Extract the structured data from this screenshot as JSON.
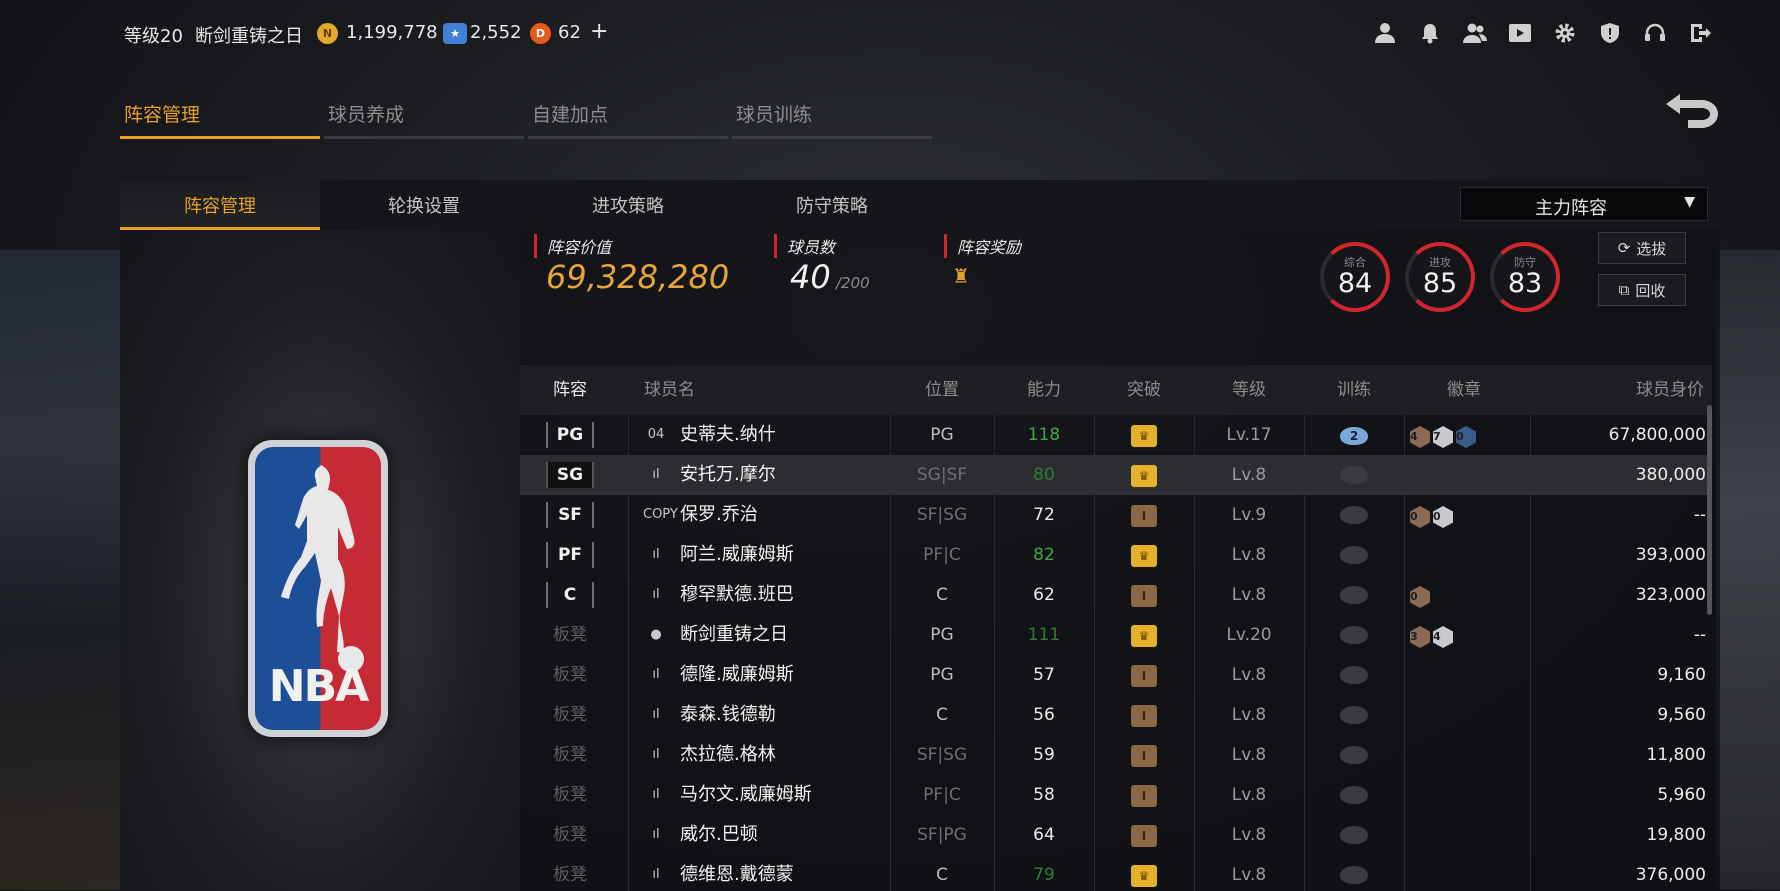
{
  "topbar": {
    "level": "等级20",
    "player_name": "断剑重铸之日",
    "coins": "1,199,778",
    "stars": "2,552",
    "tickets": "62",
    "add_label": "+",
    "icons": [
      "profile-icon",
      "bell-icon",
      "friends-icon",
      "video-icon",
      "gear-icon",
      "shield-icon",
      "headset-icon",
      "exit-icon"
    ]
  },
  "main_tabs": [
    "阵容管理",
    "球员养成",
    "自建加点",
    "球员训练"
  ],
  "sub_tabs": [
    "阵容管理",
    "轮换设置",
    "进攻策略",
    "防守策略"
  ],
  "lineup_select": {
    "value": "主力阵容"
  },
  "stats": {
    "value_label": "阵容价值",
    "value": "69,328,280",
    "count_label": "球员数",
    "count": "40",
    "count_max": "/200",
    "reward_label": "阵容奖励",
    "overall_label": "综合",
    "overall": "84",
    "offense_label": "进攻",
    "offense": "85",
    "defense_label": "防守",
    "defense": "83",
    "select_btn": "选拔",
    "recycle_btn": "回收"
  },
  "columns": [
    "阵容",
    "球员名",
    "位置",
    "能力",
    "突破",
    "等级",
    "训练",
    "徽章",
    "球员身价"
  ],
  "rows": [
    {
      "slot": "PG",
      "tag": "04",
      "name": "史蒂夫.纳什",
      "pos": "PG",
      "ability": "118",
      "ability_color": "#3fa843",
      "break": "gold",
      "level": "Lv.17",
      "train": "2",
      "badges": [
        "4",
        "7",
        "0"
      ],
      "price": "67,800,000"
    },
    {
      "slot": "SG",
      "tag": "ıl",
      "name": "安托万.摩尔",
      "pos": "SG|SF",
      "ability": "80",
      "ability_color": "#2f7d2f",
      "break": "gold",
      "level": "Lv.8",
      "train": "",
      "badges": [],
      "price": "380,000"
    },
    {
      "slot": "SF",
      "tag": "COPY",
      "name": "保罗.乔治",
      "pos": "SF|SG",
      "ability": "72",
      "ability_color": "#ececec",
      "break": "bronze",
      "level": "Lv.9",
      "train": "",
      "badges": [
        "0",
        "0"
      ],
      "price": "--"
    },
    {
      "slot": "PF",
      "tag": "ıl",
      "name": "阿兰.威廉姆斯",
      "pos": "PF|C",
      "ability": "82",
      "ability_color": "#3fa843",
      "break": "gold",
      "level": "Lv.8",
      "train": "",
      "badges": [],
      "price": "393,000"
    },
    {
      "slot": "C",
      "tag": "ıl",
      "name": "穆罕默德.班巴",
      "pos": "C",
      "ability": "62",
      "ability_color": "#ececec",
      "break": "bronze",
      "level": "Lv.8",
      "train": "",
      "badges": [
        "0"
      ],
      "price": "323,000"
    },
    {
      "slot": "板凳",
      "tag": "●",
      "name": "断剑重铸之日",
      "pos": "PG",
      "ability": "111",
      "ability_color": "#2f7d2f",
      "break": "gold",
      "level": "Lv.20",
      "train": "",
      "badges": [
        "3",
        "4"
      ],
      "price": "--"
    },
    {
      "slot": "板凳",
      "tag": "ıl",
      "name": "德隆.威廉姆斯",
      "pos": "PG",
      "ability": "57",
      "ability_color": "#ececec",
      "break": "bronze",
      "level": "Lv.8",
      "train": "",
      "badges": [],
      "price": "9,160"
    },
    {
      "slot": "板凳",
      "tag": "ıl",
      "name": "泰森.钱德勒",
      "pos": "C",
      "ability": "56",
      "ability_color": "#ececec",
      "break": "bronze",
      "level": "Lv.8",
      "train": "",
      "badges": [],
      "price": "9,560"
    },
    {
      "slot": "板凳",
      "tag": "ıl",
      "name": "杰拉德.格林",
      "pos": "SF|SG",
      "ability": "59",
      "ability_color": "#ececec",
      "break": "bronze",
      "level": "Lv.8",
      "train": "",
      "badges": [],
      "price": "11,800"
    },
    {
      "slot": "板凳",
      "tag": "ıl",
      "name": "马尔文.威廉姆斯",
      "pos": "PF|C",
      "ability": "58",
      "ability_color": "#ececec",
      "break": "bronze",
      "level": "Lv.8",
      "train": "",
      "badges": [],
      "price": "5,960"
    },
    {
      "slot": "板凳",
      "tag": "ıl",
      "name": "威尔.巴顿",
      "pos": "SF|PG",
      "ability": "64",
      "ability_color": "#ececec",
      "break": "bronze",
      "level": "Lv.8",
      "train": "",
      "badges": [],
      "price": "19,800"
    },
    {
      "slot": "板凳",
      "tag": "ıl",
      "name": "德维恩.戴德蒙",
      "pos": "C",
      "ability": "79",
      "ability_color": "#2f7d2f",
      "break": "gold",
      "level": "Lv.8",
      "train": "",
      "badges": [],
      "price": "376,000"
    }
  ],
  "logo_text": "NBA"
}
